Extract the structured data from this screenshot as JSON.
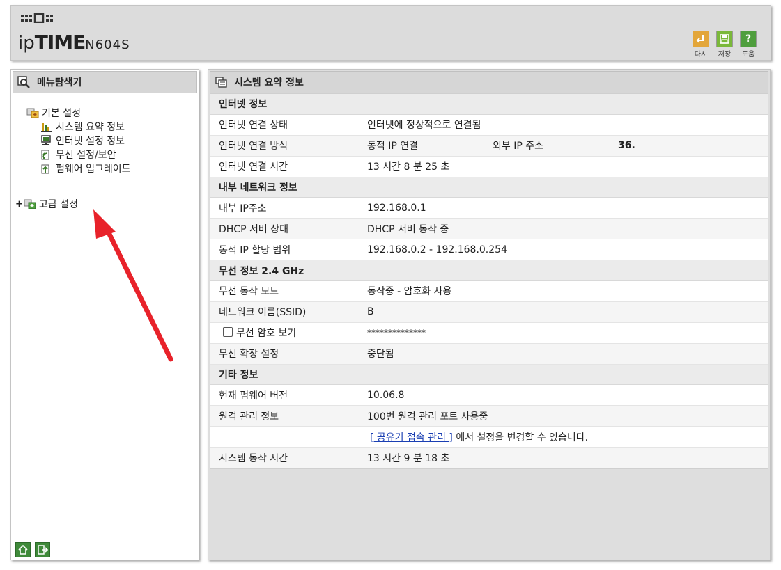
{
  "header": {
    "brand_prefix": "ip",
    "brand_main": "TIME",
    "model": "N604S",
    "buttons": [
      {
        "label": "다시",
        "icon": "undo-icon",
        "color": "#e0a030"
      },
      {
        "label": "저장",
        "icon": "save-icon",
        "color": "#6aac2f"
      },
      {
        "label": "도움",
        "icon": "help-icon",
        "color": "#4a9a3a"
      }
    ]
  },
  "left": {
    "title": "메뉴탐색기",
    "basic": {
      "label": "기본 설정",
      "items": [
        {
          "label": "시스템 요약 정보",
          "icon": "chart-icon"
        },
        {
          "label": "인터넷 설정 정보",
          "icon": "monitor-icon"
        },
        {
          "label": "무선 설정/보안",
          "icon": "wireless-icon"
        },
        {
          "label": "펌웨어 업그레이드",
          "icon": "upgrade-icon"
        }
      ]
    },
    "advanced": {
      "label": "고급 설정",
      "expander": "+"
    }
  },
  "main": {
    "title": "시스템 요약 정보",
    "sections": {
      "internet": {
        "title": "인터넷 정보",
        "status_label": "인터넷 연결 상태",
        "status_value": "인터넷에 정상적으로 연결됨",
        "method_label": "인터넷 연결 방식",
        "method_value": "동적 IP 연결",
        "external_ip_label": "외부 IP 주소",
        "external_ip_value": "36.",
        "time_label": "인터넷 연결 시간",
        "time_value": "13 시간 8 분 25 초"
      },
      "lan": {
        "title": "내부 네트워크 정보",
        "ip_label": "내부 IP주소",
        "ip_value": "192.168.0.1",
        "dhcp_label": "DHCP 서버 상태",
        "dhcp_value": "DHCP 서버 동작 중",
        "range_label": "동적 IP 할당 범위",
        "range_value": "192.168.0.2 -  192.168.0.254"
      },
      "wireless": {
        "title": "무선 정보 2.4 GHz",
        "mode_label": "무선 동작 모드",
        "mode_value": "동작중 - 암호화 사용",
        "ssid_label": "네트워크 이름(SSID)",
        "ssid_value": "B",
        "pw_label": "무선 암호 보기",
        "pw_value": "**************",
        "ext_label": "무선 확장 설정",
        "ext_value": "중단됨"
      },
      "etc": {
        "title": "기타 정보",
        "fw_label": "현재 펌웨어 버전",
        "fw_value": "10.06.8",
        "remote_label": "원격 관리 정보",
        "remote_value": "100번 원격 관리 포트 사용중",
        "remote_link": "[ 공유기 접속 관리 ]",
        "remote_note": " 에서 설정을 변경할 수 있습니다.",
        "uptime_label": "시스템 동작 시간",
        "uptime_value": "13 시간 9 분 18 초"
      }
    }
  },
  "annotation": {
    "arrow_color": "#e8222a"
  }
}
